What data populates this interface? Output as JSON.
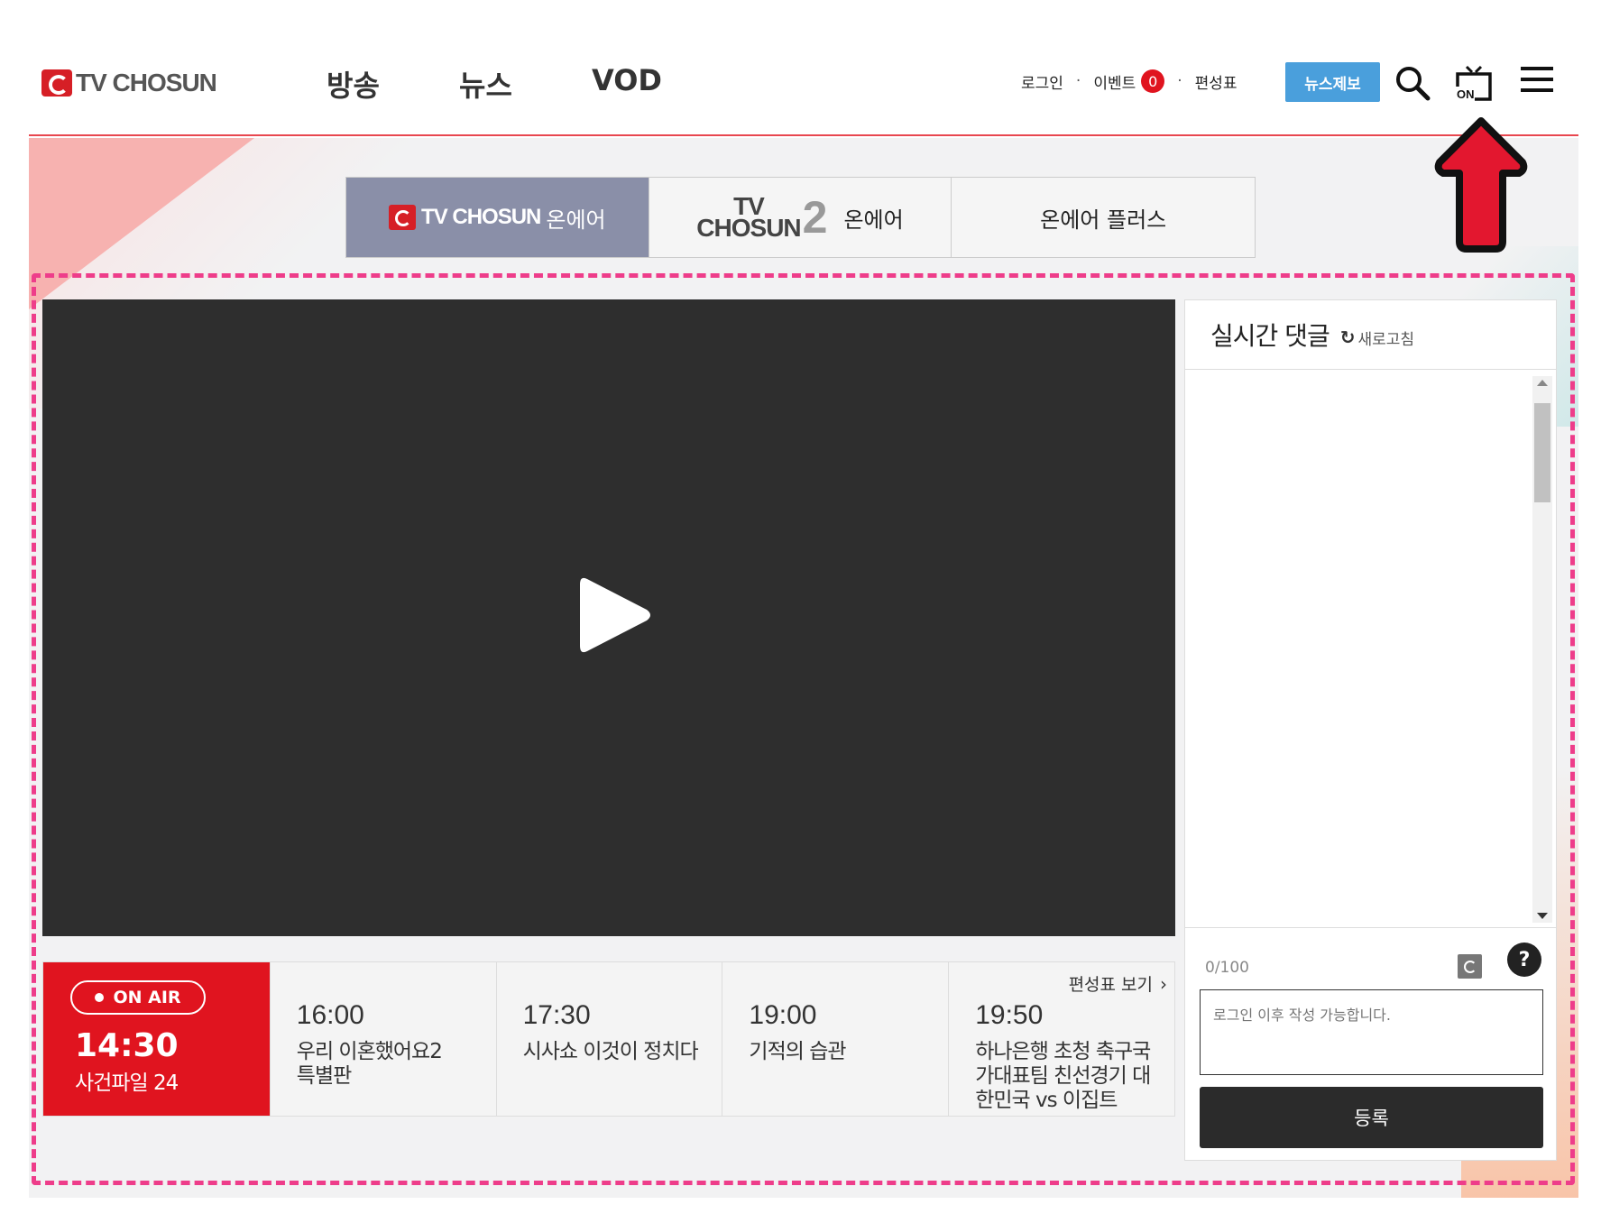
{
  "header": {
    "logo_text": "TV CHOSUN",
    "nav": [
      "방송",
      "뉴스",
      "VOD"
    ],
    "util": {
      "login": "로그인",
      "event": "이벤트",
      "event_count": "0",
      "schedule": "편성표"
    },
    "report_button": "뉴스제보",
    "icons": {
      "search": "search-icon",
      "onair": "on-air-tv-icon",
      "menu": "hamburger-menu-icon"
    },
    "onair_icon_label": "ON"
  },
  "channel_tabs": [
    {
      "brand": "TV CHOSUN",
      "label": "온에어",
      "active": true
    },
    {
      "brand_top": "TV",
      "brand_bottom": "CHOSUN",
      "brand_num": "2",
      "label": "온에어",
      "active": false
    },
    {
      "label": "온에어 플러스",
      "active": false
    }
  ],
  "player": {
    "play_icon": "play-icon"
  },
  "schedule": {
    "onair_label": "ON AIR",
    "current": {
      "time": "14:30",
      "title": "사건파일 24"
    },
    "link": "편성표 보기",
    "items": [
      {
        "time": "16:00",
        "title": "우리 이혼했어요2 특별판"
      },
      {
        "time": "17:30",
        "title": "시사쇼 이것이 정치다"
      },
      {
        "time": "19:00",
        "title": "기적의 습관"
      },
      {
        "time": "19:50",
        "title": "하나은행 초청 축구국가대표팀 친선경기 대한민국 vs 이집트"
      }
    ]
  },
  "comments": {
    "title": "실시간 댓글",
    "refresh": "새로고침",
    "counter": "0/100",
    "placeholder": "로그인 이후 작성 가능합니다.",
    "submit": "등록",
    "help": "?"
  },
  "colors": {
    "brand_red": "#e0141f",
    "accent_blue": "#4a9fdc",
    "highlight_pink": "#ee3d8a",
    "active_tab": "#8a8fa8",
    "player_bg": "#2e2e2e"
  }
}
